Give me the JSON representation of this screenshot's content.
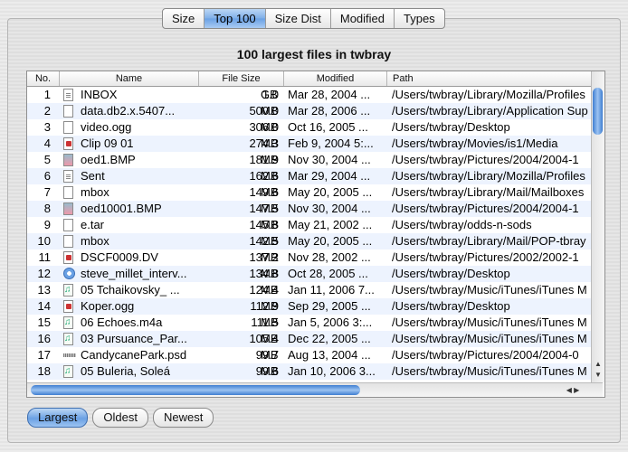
{
  "tabs": [
    {
      "label": "Size",
      "active": false
    },
    {
      "label": "Top 100",
      "active": true
    },
    {
      "label": "Size Dist",
      "active": false
    },
    {
      "label": "Modified",
      "active": false
    },
    {
      "label": "Types",
      "active": false
    }
  ],
  "heading": "100 largest files in twbray",
  "columns": {
    "no": "No.",
    "name": "Name",
    "size": "File Size",
    "modified": "Modified",
    "path": "Path"
  },
  "rows": [
    {
      "no": "1",
      "icon": "text",
      "name": "INBOX",
      "size": "1.0",
      "unit": "GB",
      "modified": "Mar 28, 2004 ...",
      "path": "/Users/twbray/Library/Mozilla/Profiles"
    },
    {
      "no": "2",
      "icon": "blank",
      "name": "data.db2.x.5407...",
      "size": "500.0",
      "unit": "MB",
      "modified": "Mar 28, 2006 ...",
      "path": "/Users/twbray/Library/Application Sup"
    },
    {
      "no": "3",
      "icon": "blank",
      "name": "video.ogg",
      "size": "306.0",
      "unit": "MB",
      "modified": "Oct 16, 2005 ...",
      "path": "/Users/twbray/Desktop"
    },
    {
      "no": "4",
      "icon": "video",
      "name": "Clip 09 01",
      "size": "274.3",
      "unit": "MB",
      "modified": "Feb 9, 2004 5:...",
      "path": "/Users/twbray/Movies/is1/Media"
    },
    {
      "no": "5",
      "icon": "img",
      "name": "oed1.BMP",
      "size": "181.9",
      "unit": "MB",
      "modified": "Nov 30, 2004 ...",
      "path": "/Users/twbray/Pictures/2004/2004-1"
    },
    {
      "no": "6",
      "icon": "text",
      "name": "Sent",
      "size": "162.6",
      "unit": "MB",
      "modified": "Mar 29, 2004 ...",
      "path": "/Users/twbray/Library/Mozilla/Profiles"
    },
    {
      "no": "7",
      "icon": "blank",
      "name": "mbox",
      "size": "149.6",
      "unit": "MB",
      "modified": "May 20, 2005 ...",
      "path": "/Users/twbray/Library/Mail/Mailboxes"
    },
    {
      "no": "8",
      "icon": "img",
      "name": "oed10001.BMP",
      "size": "147.5",
      "unit": "MB",
      "modified": "Nov 30, 2004 ...",
      "path": "/Users/twbray/Pictures/2004/2004-1"
    },
    {
      "no": "9",
      "icon": "blank",
      "name": "e.tar",
      "size": "145.8",
      "unit": "MB",
      "modified": "May 21, 2002 ...",
      "path": "/Users/twbray/odds-n-sods"
    },
    {
      "no": "10",
      "icon": "blank",
      "name": "mbox",
      "size": "142.5",
      "unit": "MB",
      "modified": "May 20, 2005 ...",
      "path": "/Users/twbray/Library/Mail/POP-tbray"
    },
    {
      "no": "11",
      "icon": "video",
      "name": "DSCF0009.DV",
      "size": "137.2",
      "unit": "MB",
      "modified": "Nov 28, 2002 ...",
      "path": "/Users/twbray/Pictures/2002/2002-1"
    },
    {
      "no": "12",
      "icon": "qt",
      "name": "steve_millet_interv...",
      "size": "134.8",
      "unit": "MB",
      "modified": "Oct 28, 2005 ...",
      "path": "/Users/twbray/Desktop"
    },
    {
      "no": "13",
      "icon": "music",
      "name": "05 Tchaikovsky_ ...",
      "size": "124.4",
      "unit": "MB",
      "modified": "Jan 11, 2006 7...",
      "path": "/Users/twbray/Music/iTunes/iTunes M"
    },
    {
      "no": "14",
      "icon": "video",
      "name": "Koper.ogg",
      "size": "112.9",
      "unit": "MB",
      "modified": "Sep 29, 2005 ...",
      "path": "/Users/twbray/Desktop"
    },
    {
      "no": "15",
      "icon": "music",
      "name": "06 Echoes.m4a",
      "size": "111.5",
      "unit": "MB",
      "modified": "Jan 5, 2006 3:...",
      "path": "/Users/twbray/Music/iTunes/iTunes M"
    },
    {
      "no": "16",
      "icon": "music",
      "name": "03 Pursuance_Par...",
      "size": "105.4",
      "unit": "MB",
      "modified": "Dec 22, 2005 ...",
      "path": "/Users/twbray/Music/iTunes/iTunes M"
    },
    {
      "no": "17",
      "icon": "bar",
      "name": "CandycanePark.psd",
      "size": "99.7",
      "unit": "MB",
      "modified": "Aug 13, 2004 ...",
      "path": "/Users/twbray/Pictures/2004/2004-0"
    },
    {
      "no": "18",
      "icon": "music",
      "name": "05 Buleria, Soleá",
      "size": "99.6",
      "unit": "MB",
      "modified": "Jan 10, 2006 3...",
      "path": "/Users/twbray/Music/iTunes/iTunes M"
    }
  ],
  "buttons": [
    {
      "label": "Largest",
      "active": true
    },
    {
      "label": "Oldest",
      "active": false
    },
    {
      "label": "Newest",
      "active": false
    }
  ],
  "icons": {
    "text": "text-file-icon",
    "blank": "document-icon",
    "video": "video-file-icon",
    "img": "image-file-icon",
    "music": "audio-file-icon",
    "qt": "quicktime-file-icon",
    "bar": "photoshop-file-icon"
  },
  "colors": {
    "accent": "#6aa1e4",
    "row_alt": "#edf3fe"
  }
}
